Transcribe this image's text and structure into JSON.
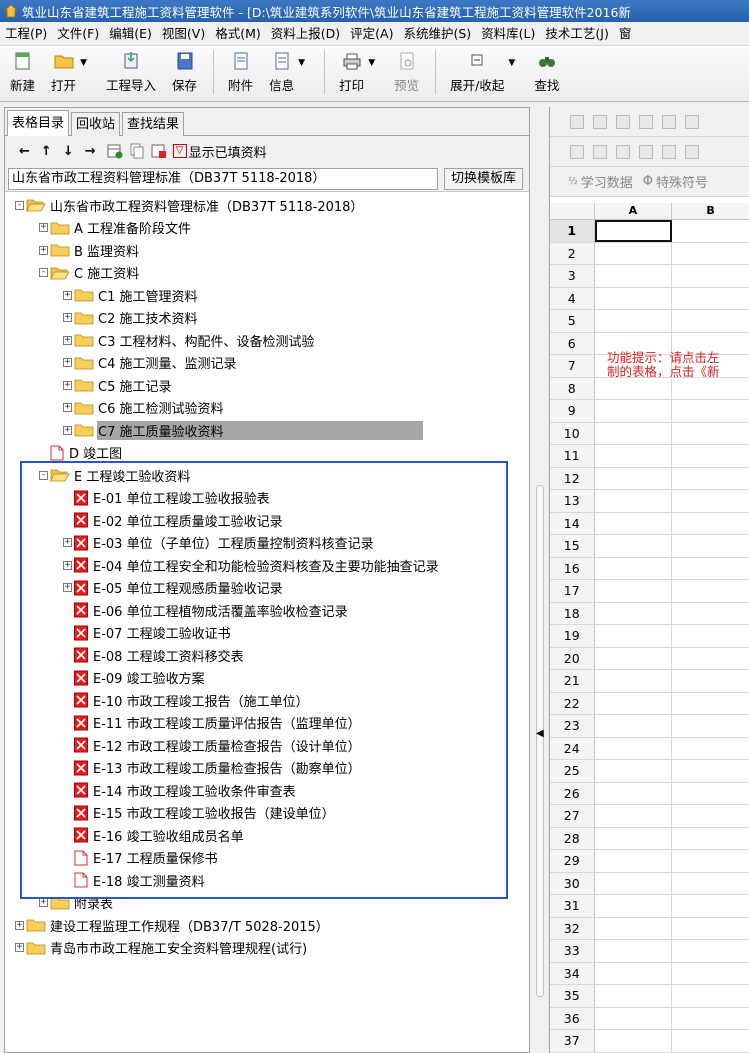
{
  "window": {
    "title": "筑业山东省建筑工程施工资料管理软件 - [D:\\筑业建筑系列软件\\筑业山东省建筑工程施工资料管理软件2016新"
  },
  "menu": [
    "工程(P)",
    "文件(F)",
    "编辑(E)",
    "视图(V)",
    "格式(M)",
    "资料上报(D)",
    "评定(A)",
    "系统维护(S)",
    "资料库(L)",
    "技术工艺(J)",
    "窗"
  ],
  "toolbar": {
    "new": "新建",
    "open": "打开",
    "import": "工程导入",
    "save": "保存",
    "attach": "附件",
    "info": "信息",
    "print": "打印",
    "preview": "预览",
    "expand": "展开/收起",
    "find": "查找"
  },
  "left": {
    "tabs": [
      "表格目录",
      "回收站",
      "查找结果"
    ],
    "show_filled": "显示已填资料",
    "standard": "山东省市政工程资料管理标准（DB37T 5118-2018）",
    "switch_btn": "切换模板库",
    "tree": [
      {
        "label": "山东省市政工程资料管理标准（DB37T 5118-2018）",
        "indent": 0,
        "exp": "-",
        "icon": "open"
      },
      {
        "label": "A 工程准备阶段文件",
        "indent": 1,
        "exp": "+",
        "icon": "folder"
      },
      {
        "label": "B 监理资料",
        "indent": 1,
        "exp": "+",
        "icon": "folder"
      },
      {
        "label": "C 施工资料",
        "indent": 1,
        "exp": "-",
        "icon": "open"
      },
      {
        "label": "C1 施工管理资料",
        "indent": 2,
        "exp": "+",
        "icon": "folder"
      },
      {
        "label": "C2 施工技术资料",
        "indent": 2,
        "exp": "+",
        "icon": "folder"
      },
      {
        "label": "C3 工程材料、构配件、设备检测试验",
        "indent": 2,
        "exp": "+",
        "icon": "folder"
      },
      {
        "label": "C4 施工测量、监测记录",
        "indent": 2,
        "exp": "+",
        "icon": "folder"
      },
      {
        "label": "C5 施工记录",
        "indent": 2,
        "exp": "+",
        "icon": "folder"
      },
      {
        "label": "C6 施工检测试验资料",
        "indent": 2,
        "exp": "+",
        "icon": "folder"
      },
      {
        "label": "C7 施工质量验收资料",
        "indent": 2,
        "exp": "+",
        "icon": "folder",
        "selected": true
      },
      {
        "label": "D 竣工图",
        "indent": 1,
        "exp": "",
        "icon": "doc"
      },
      {
        "label": "E 工程竣工验收资料",
        "indent": 1,
        "exp": "-",
        "icon": "open"
      },
      {
        "label": "E-01 单位工程竣工验收报验表",
        "indent": 2,
        "exp": "",
        "icon": "red"
      },
      {
        "label": "E-02 单位工程质量竣工验收记录",
        "indent": 2,
        "exp": "",
        "icon": "red"
      },
      {
        "label": "E-03 单位（子单位）工程质量控制资料核查记录",
        "indent": 2,
        "exp": "+",
        "icon": "red"
      },
      {
        "label": "E-04 单位工程安全和功能检验资料核查及主要功能抽查记录",
        "indent": 2,
        "exp": "+",
        "icon": "red"
      },
      {
        "label": "E-05 单位工程观感质量验收记录",
        "indent": 2,
        "exp": "+",
        "icon": "red"
      },
      {
        "label": "E-06 单位工程植物成活覆盖率验收检查记录",
        "indent": 2,
        "exp": "",
        "icon": "red"
      },
      {
        "label": "E-07 工程竣工验收证书",
        "indent": 2,
        "exp": "",
        "icon": "red"
      },
      {
        "label": "E-08 工程竣工资料移交表",
        "indent": 2,
        "exp": "",
        "icon": "red"
      },
      {
        "label": "E-09 竣工验收方案",
        "indent": 2,
        "exp": "",
        "icon": "red"
      },
      {
        "label": "E-10 市政工程竣工报告（施工单位）",
        "indent": 2,
        "exp": "",
        "icon": "red"
      },
      {
        "label": "E-11 市政工程竣工质量评估报告（监理单位）",
        "indent": 2,
        "exp": "",
        "icon": "red"
      },
      {
        "label": "E-12 市政工程竣工质量检查报告（设计单位）",
        "indent": 2,
        "exp": "",
        "icon": "red"
      },
      {
        "label": "E-13 市政工程竣工质量检查报告（勘察单位）",
        "indent": 2,
        "exp": "",
        "icon": "red"
      },
      {
        "label": "E-14 市政工程竣工验收条件审查表",
        "indent": 2,
        "exp": "",
        "icon": "red"
      },
      {
        "label": "E-15 市政工程竣工验收报告（建设单位）",
        "indent": 2,
        "exp": "",
        "icon": "red"
      },
      {
        "label": "E-16 竣工验收组成员名单",
        "indent": 2,
        "exp": "",
        "icon": "red"
      },
      {
        "label": "E-17 工程质量保修书",
        "indent": 2,
        "exp": "",
        "icon": "doc"
      },
      {
        "label": "E-18 竣工测量资料",
        "indent": 2,
        "exp": "",
        "icon": "doc"
      },
      {
        "label": "附录表",
        "indent": 1,
        "exp": "+",
        "icon": "folder"
      },
      {
        "label": "建设工程监理工作规程（DB37/T 5028-2015）",
        "indent": 0,
        "exp": "+",
        "icon": "folder"
      },
      {
        "label": "青岛市市政工程施工安全资料管理规程(试行)",
        "indent": 0,
        "exp": "+",
        "icon": "folder"
      }
    ]
  },
  "right": {
    "tool3_study": "学习数据",
    "tool3_symbol": "特殊符号",
    "columns": [
      "A",
      "B"
    ],
    "rows": [
      "1",
      "2",
      "3",
      "4",
      "5",
      "6",
      "7",
      "8",
      "9",
      "10",
      "11",
      "12",
      "13",
      "14",
      "15",
      "16",
      "17",
      "18",
      "19",
      "20",
      "21",
      "22",
      "23",
      "24",
      "25",
      "26",
      "27",
      "28",
      "29",
      "30",
      "31",
      "32",
      "33",
      "34",
      "35",
      "36",
      "37"
    ],
    "hint_line1": "功能提示：请点击左",
    "hint_line2": "制的表格，点击《新"
  },
  "colors": {
    "title_bg": "#2f6bb8",
    "highlight_border": "#2a55c5",
    "hint": "#e02020",
    "selected_row": "#a6a6a6"
  }
}
